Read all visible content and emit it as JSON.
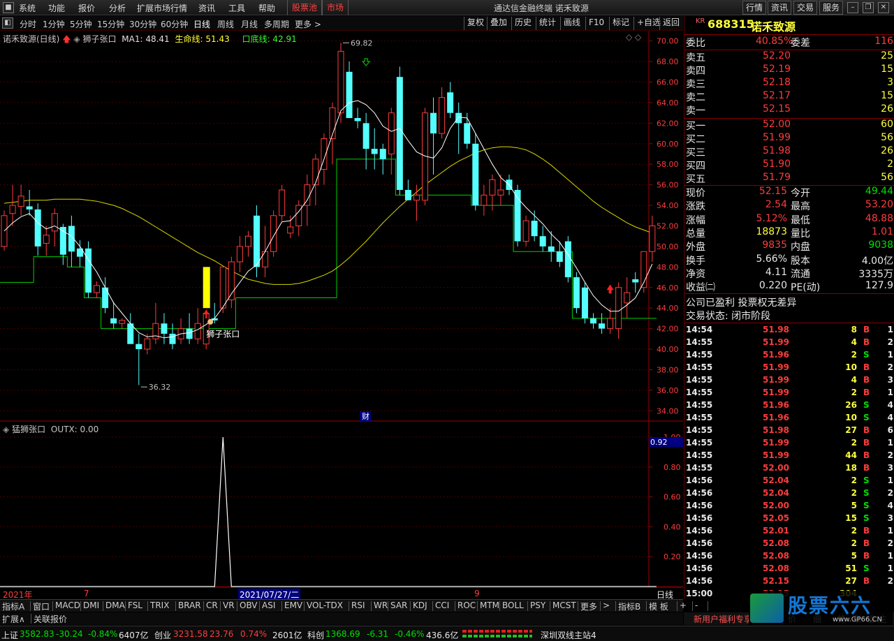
{
  "menu": {
    "items": [
      "系统",
      "功能",
      "报价",
      "分析",
      "扩展市场行情",
      "资讯",
      "工具",
      "帮助"
    ],
    "special": [
      "股票池",
      "市场"
    ],
    "app_title": "通达信金融终端 诺禾致源",
    "right_buttons": [
      "行情",
      "资讯",
      "交易",
      "服务"
    ]
  },
  "toolbar": {
    "periods": [
      "分时",
      "1分钟",
      "5分钟",
      "15分钟",
      "30分钟",
      "60分钟",
      "日线",
      "周线",
      "月线",
      "多周期",
      "更多 >"
    ],
    "tools": [
      "复权",
      "叠加",
      "历史",
      "统计",
      "画线",
      "F10",
      "标记",
      "+自选",
      "返回"
    ]
  },
  "chart_header": {
    "name": "诺禾致源(日线)",
    "indicator": "狮子张口",
    "ma1": "MA1: 48.41",
    "life": "生命线: 51.43",
    "bottom": "口底线: 42.91"
  },
  "annotations": {
    "high": "69.82",
    "low": "36.32",
    "signal": "狮子张口",
    "fin": "财"
  },
  "sub_header": {
    "name": "猛狮张口",
    "value": "OUTX: 0.00",
    "cursor_value": "0.92"
  },
  "time_axis": {
    "labels": [
      "2021年",
      "7",
      "2021/07/27/二",
      "9"
    ],
    "period": "日线"
  },
  "chart_data": [
    {
      "type": "candlestick",
      "ylim": [
        33,
        71
      ],
      "ticks": [
        "70.00",
        "68.00",
        "66.00",
        "64.00",
        "62.00",
        "60.00",
        "58.00",
        "56.00",
        "54.00",
        "52.00",
        "50.00",
        "48.00",
        "46.00",
        "44.00",
        "42.00",
        "40.00",
        "38.00",
        "36.00",
        "34.00"
      ],
      "candles": [
        [
          50.0,
          53.5,
          49.6,
          53.0
        ],
        [
          53.2,
          56.0,
          52.0,
          54.0
        ],
        [
          53.9,
          56.0,
          53.0,
          54.9
        ],
        [
          53.9,
          55.5,
          53.0,
          53.6
        ],
        [
          53.6,
          54.2,
          49.1,
          50.0
        ],
        [
          50.3,
          52.0,
          49.1,
          51.1
        ],
        [
          51.5,
          53.7,
          50.0,
          53.2
        ],
        [
          51.9,
          52.2,
          48.2,
          49.2
        ],
        [
          52.0,
          53.0,
          48.0,
          49.5
        ],
        [
          49.8,
          50.6,
          48.0,
          49.0
        ],
        [
          49.8,
          50.5,
          45.0,
          45.5
        ],
        [
          45.5,
          46.6,
          45.0,
          46.2
        ],
        [
          46.0,
          47.0,
          43.5,
          44.0
        ],
        [
          43.0,
          44.6,
          42.0,
          42.5
        ],
        [
          42.5,
          43.0,
          42.0,
          42.8
        ],
        [
          42.5,
          43.5,
          40.5,
          40.5
        ],
        [
          40.5,
          41.5,
          36.5,
          40.0
        ],
        [
          40.0,
          41.5,
          39.5,
          41.0
        ],
        [
          41.0,
          44.5,
          40.5,
          42.5
        ],
        [
          42.5,
          43.5,
          40.5,
          41.5
        ],
        [
          41.5,
          42.5,
          40.0,
          40.5
        ],
        [
          41.0,
          43.0,
          40.5,
          42.0
        ],
        [
          42.0,
          43.5,
          40.5,
          41.0
        ],
        [
          41.0,
          44.0,
          40.5,
          42.5
        ],
        [
          40.5,
          43.6,
          40.0,
          43.5
        ],
        [
          43.0,
          44.5,
          42.5,
          42.8
        ],
        [
          44.0,
          48.0,
          43.5,
          48.0
        ],
        [
          44.8,
          49.0,
          44.0,
          48.5
        ],
        [
          48.5,
          51.0,
          47.5,
          50.0
        ],
        [
          50.0,
          51.5,
          49.0,
          51.0
        ],
        [
          53.0,
          54.0,
          47.0,
          48.0
        ],
        [
          48.0,
          52.0,
          47.0,
          49.5
        ],
        [
          49.5,
          53.5,
          49.0,
          53.0
        ],
        [
          53.0,
          56.0,
          52.5,
          55.5
        ],
        [
          51.3,
          53.0,
          50.8,
          51.9
        ],
        [
          52.0,
          54.5,
          51.0,
          54.0
        ],
        [
          54.0,
          57.0,
          52.0,
          56.0
        ],
        [
          56.0,
          59.0,
          54.0,
          58.5
        ],
        [
          57.5,
          61.0,
          56.0,
          60.5
        ],
        [
          60.5,
          64.0,
          58.0,
          63.5
        ],
        [
          63.0,
          69.82,
          62.0,
          69.0
        ],
        [
          67.0,
          68.0,
          62.5,
          62.5
        ],
        [
          62.5,
          63.5,
          61.5,
          62.2
        ],
        [
          62.0,
          63.0,
          57.5,
          59.5
        ],
        [
          59.5,
          61.5,
          57.5,
          59.0
        ],
        [
          59.5,
          60.0,
          57.0,
          58.5
        ],
        [
          59.0,
          63.5,
          57.0,
          63.0
        ],
        [
          66.5,
          67.5,
          55.0,
          55.5
        ],
        [
          55.5,
          56.5,
          54.5,
          54.5
        ],
        [
          54.5,
          56.0,
          52.5,
          55.0
        ],
        [
          54.5,
          63.5,
          54.0,
          63.0
        ],
        [
          63.0,
          64.5,
          57.0,
          61.0
        ],
        [
          61.0,
          65.5,
          60.5,
          64.5
        ],
        [
          65.0,
          66.0,
          62.5,
          63.0
        ],
        [
          63.0,
          64.0,
          59.0,
          62.0
        ],
        [
          62.0,
          63.0,
          59.5,
          60.0
        ],
        [
          60.0,
          61.0,
          53.5,
          54.0
        ],
        [
          54.0,
          56.0,
          53.0,
          55.0
        ],
        [
          55.0,
          57.0,
          53.5,
          56.5
        ],
        [
          55.0,
          57.0,
          54.0,
          55.5
        ],
        [
          56.5,
          57.0,
          55.0,
          55.5
        ],
        [
          55.5,
          56.0,
          50.0,
          50.5
        ],
        [
          50.5,
          53.0,
          50.0,
          52.5
        ],
        [
          52.5,
          53.5,
          50.5,
          51.0
        ],
        [
          51.0,
          52.0,
          49.5,
          50.0
        ],
        [
          50.0,
          51.5,
          48.5,
          49.5
        ],
        [
          49.5,
          50.5,
          48.0,
          48.5
        ],
        [
          50.5,
          51.0,
          46.5,
          47.0
        ],
        [
          47.0,
          47.5,
          43.5,
          44.0
        ],
        [
          46.0,
          46.5,
          42.5,
          43.0
        ],
        [
          43.0,
          43.5,
          42.0,
          42.5
        ],
        [
          42.5,
          43.5,
          41.5,
          42.0
        ],
        [
          42.0,
          44.0,
          41.5,
          43.0
        ],
        [
          42.0,
          46.5,
          41.0,
          46.0
        ],
        [
          44.5,
          47.0,
          43.0,
          45.5
        ],
        [
          46.8,
          47.5,
          45.5,
          46.5
        ],
        [
          46.0,
          49.5,
          45.5,
          49.5
        ],
        [
          49.5,
          53.0,
          48.5,
          52.0
        ]
      ],
      "ma1": [
        51.5,
        52.3,
        52.9,
        53.2,
        52.3,
        51.7,
        52.0,
        51.5,
        51.0,
        50.0,
        48.7,
        47.5,
        46.0,
        44.5,
        43.5,
        42.5,
        41.6,
        41.2,
        41.3,
        41.1,
        41.2,
        41.5,
        41.6,
        41.9,
        42.4,
        43.0,
        44.1,
        45.4,
        46.5,
        47.6,
        48.2,
        49.5,
        51.0,
        52.4,
        52.5,
        53.4,
        54.5,
        56.2,
        58.5,
        60.9,
        63.2,
        64.0,
        64.2,
        63.8,
        63.0,
        61.7,
        61.2,
        61.5,
        60.3,
        59.2,
        58.8,
        58.6,
        59.6,
        61.5,
        62.6,
        62.5,
        61.0,
        59.5,
        58.0,
        56.7,
        56.0,
        54.7,
        53.8,
        53.0,
        52.2,
        51.2,
        50.4,
        49.2,
        47.9,
        46.5,
        45.2,
        44.3,
        43.7,
        43.7,
        44.3,
        45.0,
        46.5,
        48.3
      ],
      "life_line": [
        54.2,
        54.3,
        54.4,
        54.5,
        54.5,
        54.5,
        54.6,
        54.6,
        54.6,
        54.6,
        54.5,
        54.4,
        54.2,
        54.0,
        53.7,
        53.3,
        52.9,
        52.4,
        51.9,
        51.4,
        50.9,
        50.4,
        49.9,
        49.4,
        49.0,
        48.6,
        48.1,
        47.6,
        47.2,
        46.8,
        46.6,
        46.4,
        46.3,
        46.3,
        46.3,
        46.4,
        46.6,
        46.9,
        47.2,
        47.6,
        48.2,
        48.9,
        49.7,
        50.5,
        51.4,
        52.3,
        53.1,
        53.9,
        54.6,
        55.3,
        56.0,
        56.6,
        57.2,
        57.8,
        58.3,
        58.7,
        59.1,
        59.4,
        59.6,
        59.7,
        59.7,
        59.6,
        59.4,
        59.0,
        58.5,
        57.9,
        57.2,
        56.5,
        55.8,
        55.1,
        54.4,
        53.8,
        53.3,
        52.8,
        52.3,
        51.9,
        51.6,
        51.3
      ],
      "bottom_line": [
        46.5,
        46.5,
        46.5,
        46.5,
        49.0,
        49.0,
        49.0,
        49.0,
        48.0,
        48.0,
        45.0,
        45.0,
        42.0,
        42.0,
        42.0,
        42.0,
        42.0,
        42.0,
        42.0,
        42.0,
        42.0,
        42.0,
        42.0,
        42.0,
        42.0,
        42.0,
        42.0,
        42.0,
        45.0,
        45.0,
        45.0,
        45.0,
        45.0,
        45.0,
        45.0,
        45.0,
        45.0,
        45.0,
        45.0,
        45.0,
        58.5,
        58.5,
        58.5,
        58.5,
        58.5,
        58.5,
        58.5,
        55.0,
        55.0,
        55.0,
        55.0,
        55.0,
        55.0,
        55.0,
        55.0,
        55.0,
        54.0,
        54.0,
        54.0,
        54.0,
        54.0,
        49.5,
        49.5,
        49.5,
        49.5,
        49.5,
        49.5,
        49.5,
        43.0,
        43.0,
        43.0,
        43.0,
        43.0,
        43.0,
        43.0,
        43.0,
        43.0,
        43.0
      ],
      "highlight_bar": [
        44.0,
        48.0
      ]
    },
    {
      "type": "line",
      "name": "OUTX",
      "ylim": [
        0,
        1.0
      ],
      "ticks": [
        "1.00",
        "0.80",
        "0.60",
        "0.40",
        "0.20"
      ],
      "spike_index": 26,
      "spike_value": 1.0
    }
  ],
  "quote": {
    "code": "688315",
    "name": "诺禾致源",
    "badge": "KR",
    "wei_bi_label": "委比",
    "wei_bi": "40.85%",
    "wei_cha_label": "委差",
    "wei_cha": "116",
    "asks": [
      {
        "label": "卖五",
        "price": "52.20",
        "vol": "25"
      },
      {
        "label": "卖四",
        "price": "52.19",
        "vol": "15"
      },
      {
        "label": "卖三",
        "price": "52.18",
        "vol": "3"
      },
      {
        "label": "卖二",
        "price": "52.17",
        "vol": "15"
      },
      {
        "label": "卖一",
        "price": "52.15",
        "vol": "26"
      }
    ],
    "bids": [
      {
        "label": "买一",
        "price": "52.00",
        "vol": "60"
      },
      {
        "label": "买二",
        "price": "51.99",
        "vol": "56"
      },
      {
        "label": "买三",
        "price": "51.98",
        "vol": "26"
      },
      {
        "label": "买四",
        "price": "51.90",
        "vol": "2"
      },
      {
        "label": "买五",
        "price": "51.79",
        "vol": "56"
      }
    ],
    "stats": [
      [
        "现价",
        "52.15",
        "今开",
        "49.44"
      ],
      [
        "涨跌",
        "2.54",
        "最高",
        "53.20"
      ],
      [
        "涨幅",
        "5.12%",
        "最低",
        "48.88"
      ],
      [
        "总量",
        "18873",
        "量比",
        "1.01"
      ],
      [
        "外盘",
        "9835",
        "内盘",
        "9038"
      ],
      [
        "换手",
        "5.66%",
        "股本",
        "4.00亿"
      ],
      [
        "净资",
        "4.11",
        "流通",
        "3335万"
      ],
      [
        "收益㈡",
        "0.220",
        "PE(动)",
        "127.9"
      ]
    ],
    "company_note": "公司已盈利 投票权无差异",
    "trade_status": "交易状态: 闭市阶段"
  },
  "ticks": [
    [
      "14:54",
      "51.98",
      "8",
      "B",
      "1"
    ],
    [
      "14:55",
      "51.99",
      "4",
      "B",
      "2"
    ],
    [
      "14:55",
      "51.96",
      "2",
      "S",
      "1"
    ],
    [
      "14:55",
      "51.99",
      "10",
      "B",
      "2"
    ],
    [
      "14:55",
      "51.99",
      "4",
      "B",
      "3"
    ],
    [
      "14:55",
      "51.99",
      "2",
      "B",
      "1"
    ],
    [
      "14:55",
      "51.96",
      "26",
      "S",
      "4"
    ],
    [
      "14:55",
      "51.96",
      "10",
      "S",
      "4"
    ],
    [
      "14:55",
      "51.98",
      "27",
      "B",
      "6"
    ],
    [
      "14:55",
      "51.99",
      "2",
      "B",
      "1"
    ],
    [
      "14:55",
      "51.99",
      "44",
      "B",
      "2"
    ],
    [
      "14:55",
      "52.00",
      "18",
      "B",
      "3"
    ],
    [
      "14:56",
      "52.04",
      "2",
      "S",
      "1"
    ],
    [
      "14:56",
      "52.04",
      "2",
      "S",
      "2"
    ],
    [
      "14:56",
      "52.00",
      "5",
      "S",
      "4"
    ],
    [
      "14:56",
      "52.05",
      "15",
      "S",
      "3"
    ],
    [
      "14:56",
      "52.01",
      "2",
      "B",
      "1"
    ],
    [
      "14:56",
      "52.08",
      "2",
      "B",
      "2"
    ],
    [
      "14:56",
      "52.08",
      "5",
      "B",
      "1"
    ],
    [
      "14:56",
      "52.08",
      "51",
      "S",
      "1"
    ],
    [
      "14:56",
      "52.15",
      "27",
      "B",
      "2"
    ],
    [
      "15:00",
      "52.15",
      "304",
      "",
      ""
    ]
  ],
  "bottom_tabs": [
    "指标A",
    "窗口",
    "MACD",
    "DMI",
    "DMA",
    "FSL",
    "TRIX",
    "BRAR",
    "CR",
    "VR",
    "OBV",
    "ASI",
    "EMV",
    "VOL-TDX",
    "RSI",
    "WR",
    "SAR",
    "KDJ",
    "CCI",
    "ROC",
    "MTM",
    "BOLL",
    "PSY",
    "MCST",
    "更多",
    ">",
    "指标B",
    "模 板",
    "+",
    "-"
  ],
  "bottom_tabs2": [
    "扩展∧",
    "关联报价"
  ],
  "right_bottom_tabs": [
    "新用户福利专享",
    "笔",
    "价",
    "细",
    "势",
    "联",
    "值",
    "主",
    "筹"
  ],
  "status": {
    "sh_label": "上证",
    "sh": "3582.83",
    "sh_chg": "-30.24",
    "sh_pct": "-0.84%",
    "sh_amt": "6407亿",
    "cy_label": "创业",
    "cy": "3231.58",
    "cy_chg": "23.76",
    "cy_pct": "0.74%",
    "cy_amt": "2601亿",
    "kc_label": "科创",
    "kc": "1368.69",
    "kc_chg": "-6.31",
    "kc_pct": "-0.46%",
    "kc_amt": "436.6亿",
    "server": "深圳双线主站4",
    "logo_text": "股票六六",
    "logo_url": "www.GP66.CN"
  }
}
